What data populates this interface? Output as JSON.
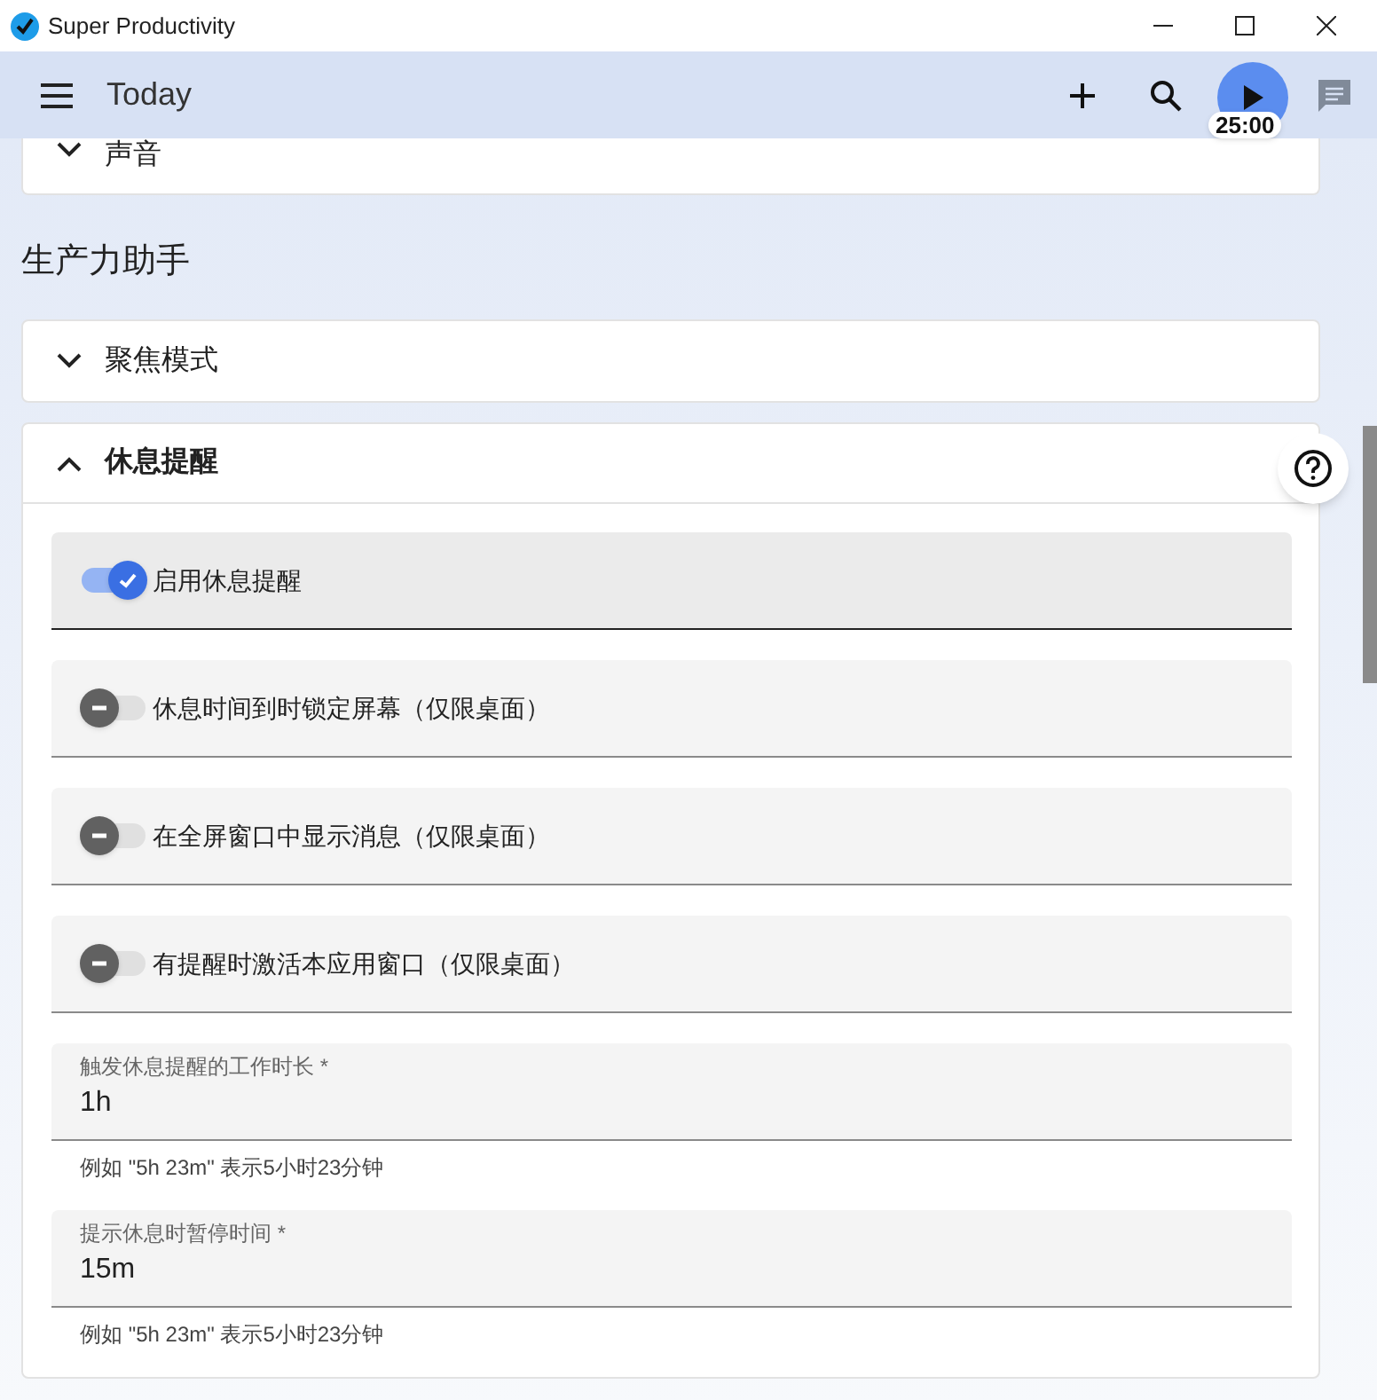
{
  "window": {
    "title": "Super Productivity"
  },
  "header": {
    "title": "Today",
    "timer": "25:00"
  },
  "top_card": {
    "title": "声音",
    "expanded": false
  },
  "section_title": "生产力助手",
  "panels": [
    {
      "title": "聚焦模式",
      "expanded": false
    },
    {
      "title": "休息提醒",
      "expanded": true,
      "settings": [
        {
          "kind": "toggle",
          "label": "启用休息提醒",
          "on": true,
          "selected": true
        },
        {
          "kind": "toggle",
          "label": "休息时间到时锁定屏幕（仅限桌面）",
          "on": false,
          "selected": false
        },
        {
          "kind": "toggle",
          "label": "在全屏窗口中显示消息（仅限桌面）",
          "on": false,
          "selected": false
        },
        {
          "kind": "toggle",
          "label": "有提醒时激活本应用窗口（仅限桌面）",
          "on": false,
          "selected": false
        },
        {
          "kind": "duration",
          "label": "触发休息提醒的工作时长 *",
          "value": "1h",
          "hint": "例如 \"5h 23m\" 表示5小时23分钟"
        },
        {
          "kind": "duration",
          "label": "提示休息时暂停时间 *",
          "value": "15m",
          "hint": "例如 \"5h 23m\" 表示5小时23分钟"
        }
      ]
    }
  ]
}
